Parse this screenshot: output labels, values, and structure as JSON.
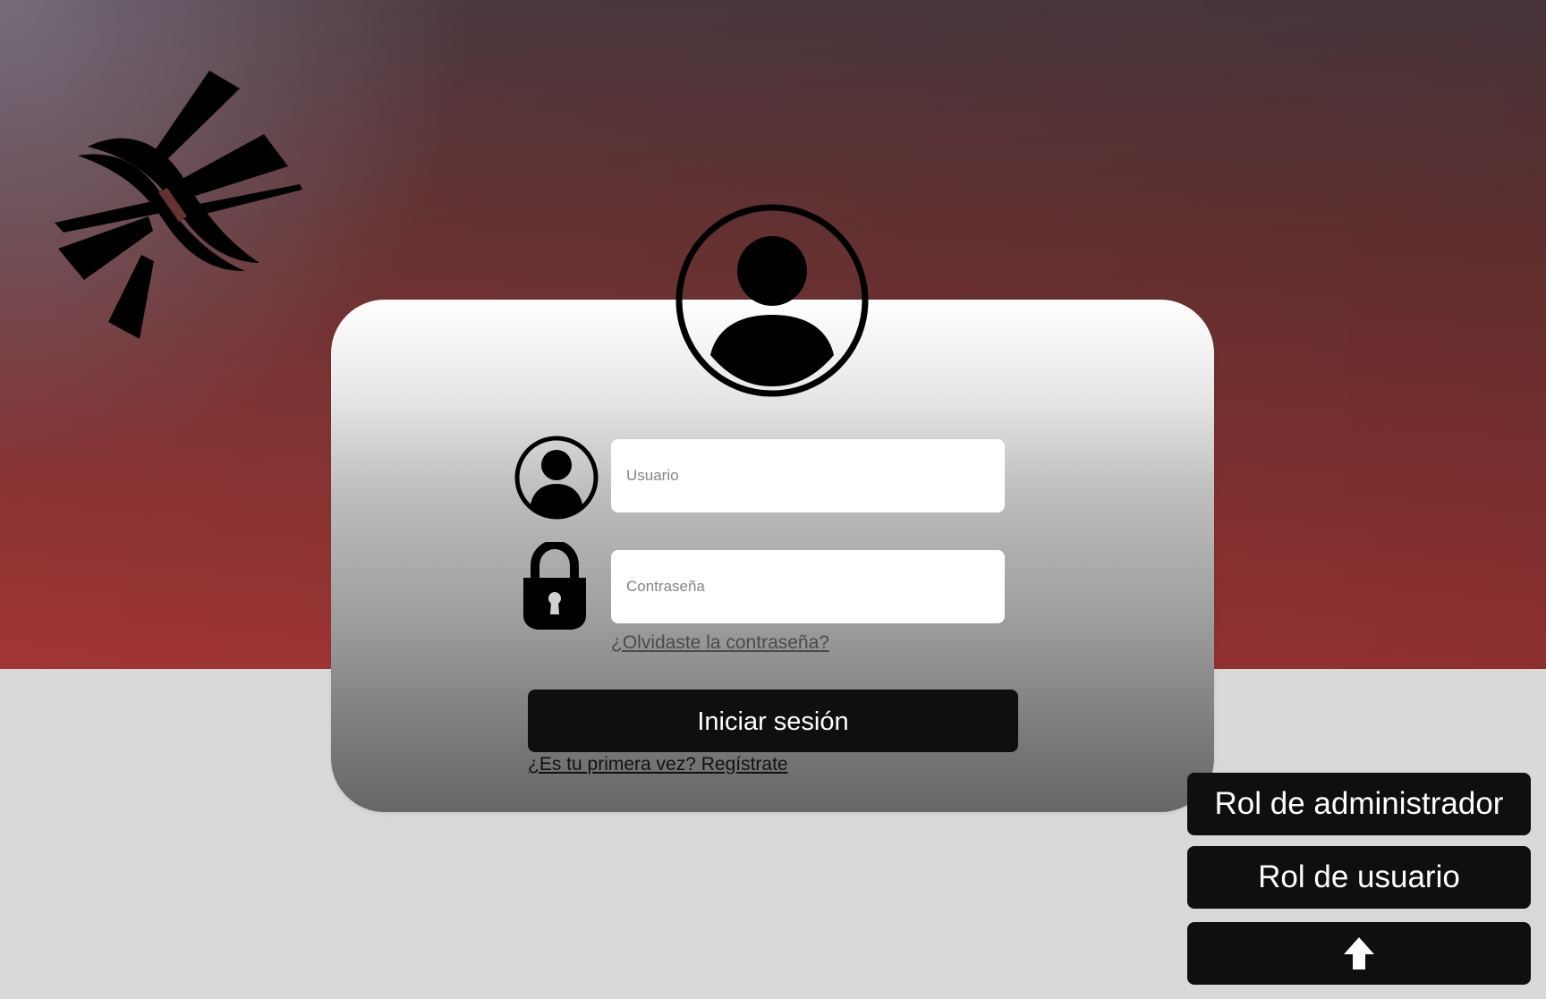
{
  "login_card": {
    "username_placeholder": "Usuario",
    "password_placeholder": "Contraseña",
    "forgot_password": "¿Olvidaste la contraseña?",
    "login_button": "Iniciar sesión",
    "register_link": "¿Es tu primera vez? Regístrate"
  },
  "role_buttons": {
    "admin": "Rol de administrador",
    "user": "Rol de usuario"
  },
  "icons": {
    "logo": "brand-logo-icon",
    "profile": "profile-avatar-icon",
    "username": "user-icon",
    "password": "lock-icon",
    "scroll_up": "arrow-up-icon"
  },
  "colors": {
    "button_bg": "#0f0f0f",
    "page_bg": "#d9d9d9",
    "hero_red": "#a23535"
  }
}
